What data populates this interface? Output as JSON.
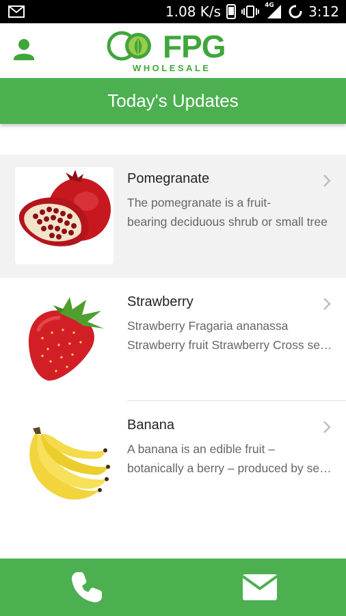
{
  "status_bar": {
    "speed": "1.08 K/s",
    "network": "4G",
    "time": "3:12"
  },
  "header": {
    "logo_text": "FPG",
    "logo_subtext": "WHOLESALE",
    "brand_color": "#3fa63c"
  },
  "title_bar": {
    "title": "Today's Updates",
    "color": "#4cb050"
  },
  "items": [
    {
      "name": "Pomegranate",
      "desc_line1": "The pomegranate is a fruit-",
      "desc_line2": "bearing deciduous shrub or small tree",
      "image_icon": "pomegranate-image"
    },
    {
      "name": "Strawberry",
      "desc_line1": "Strawberry Fragaria ananassa",
      "desc_line2": "Strawberry fruit Strawberry Cross section",
      "image_icon": "strawberry-image"
    },
    {
      "name": "Banana",
      "desc_line1": "A banana is an edible fruit –",
      "desc_line2": "botanically a berry – produced by several kinds",
      "image_icon": "banana-image"
    }
  ],
  "bottom_bar": {
    "left_icon": "phone-icon",
    "right_icon": "mail-icon"
  }
}
